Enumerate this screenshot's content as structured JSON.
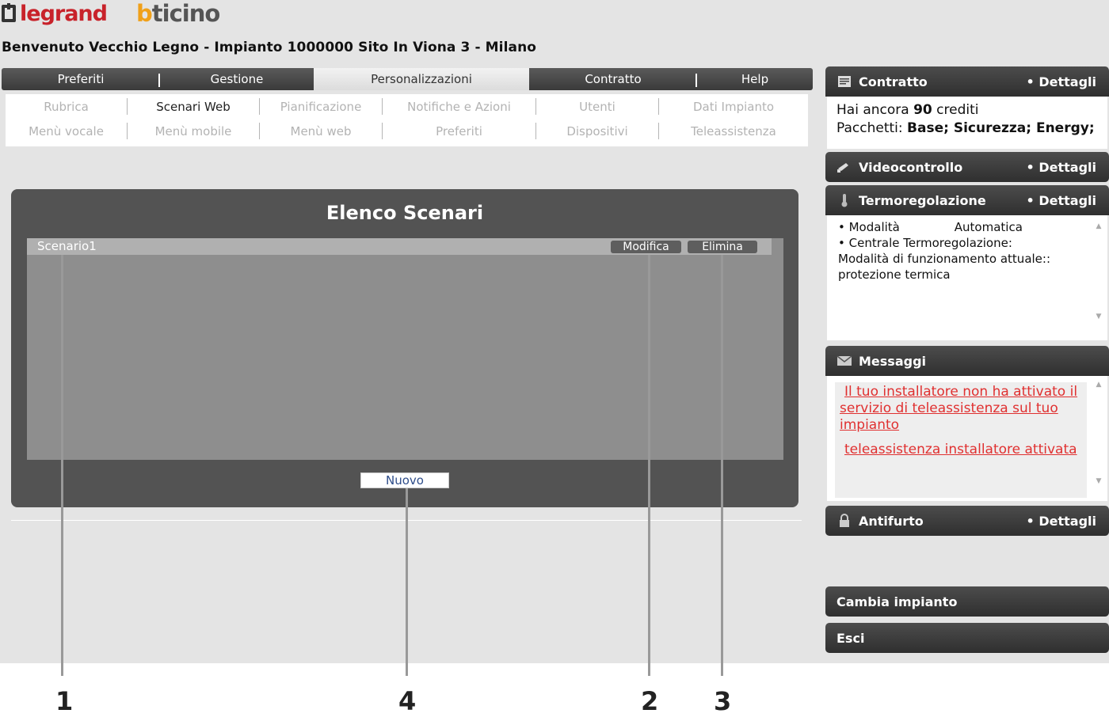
{
  "logos": {
    "legrand": "legrand",
    "bticino": "bticino"
  },
  "welcome": "Benvenuto Vecchio Legno - Impianto 1000000 Sito In Viona 3 - Milano",
  "nav": {
    "tabs": [
      {
        "label": "Preferiti"
      },
      {
        "label": "Gestione"
      },
      {
        "label": "Personalizzazioni",
        "active": true
      },
      {
        "label": "Contratto"
      },
      {
        "label": "Help"
      }
    ]
  },
  "subnav": {
    "row1": [
      "Rubrica",
      "Scenari Web",
      "Pianificazione",
      "Notifiche e Azioni",
      "Utenti",
      "Dati Impianto"
    ],
    "row2": [
      "Menù vocale",
      "Menù mobile",
      "Menù web",
      "Preferiti",
      "Dispositivi",
      "Teleassistenza"
    ],
    "active": "Scenari Web"
  },
  "panel": {
    "title": "Elenco Scenari",
    "scenario_name": "Scenario1",
    "modifica_label": "Modifica",
    "elimina_label": "Elimina",
    "nuovo_label": "Nuovo"
  },
  "sidebar": {
    "contratto": {
      "title": "Contratto",
      "dettagli": "• Dettagli",
      "line1_prefix": "Hai ancora",
      "credits": "90",
      "line1_suffix": "crediti",
      "packages_label": "Pacchetti:",
      "packages": "Base; Sicurezza; Energy;"
    },
    "videocontrollo": {
      "title": "Videocontrollo",
      "dettagli": "• Dettagli"
    },
    "termoregolazione": {
      "title": "Termoregolazione",
      "dettagli": "• Dettagli",
      "mode_label": "• Modalità",
      "mode_value": "Automatica",
      "central_label": "• Centrale Termoregolazione:",
      "status_label": "Modalità di funzionamento attuale::",
      "status_value": "protezione termica"
    },
    "messaggi": {
      "title": "Messaggi",
      "msg1": "Il tuo installatore non ha attivato il servizio di teleassistenza sul tuo impianto",
      "msg2": "teleassistenza installatore attivata"
    },
    "antifurto": {
      "title": "Antifurto",
      "dettagli": "• Dettagli"
    },
    "cambia_impianto": "Cambia impianto",
    "esci": "Esci"
  },
  "callouts": [
    "1",
    "4",
    "2",
    "3"
  ],
  "colors": {
    "link_red": "#e03030",
    "header_dark": "#3a3a3a",
    "panel_grey": "#535353"
  }
}
